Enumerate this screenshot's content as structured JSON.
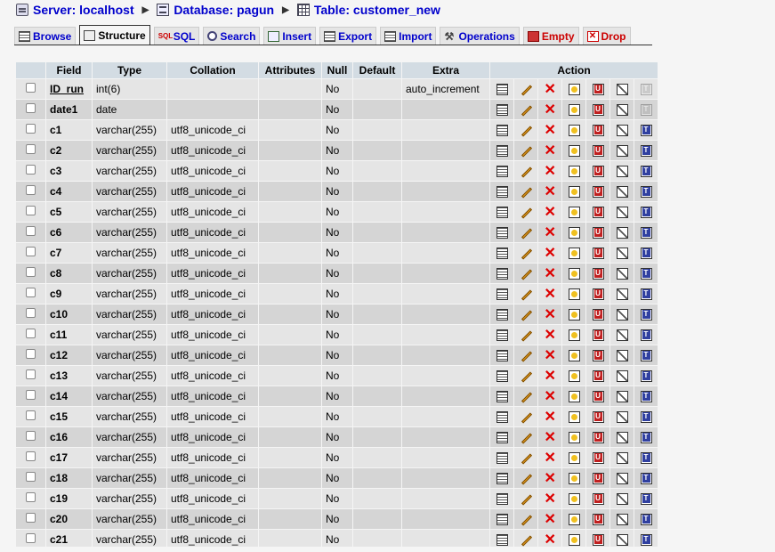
{
  "breadcrumb": {
    "server": "Server: localhost",
    "database": "Database: pagun",
    "table": "Table: customer_new"
  },
  "tabs": [
    {
      "label": "Browse",
      "icon": "browse-icon",
      "active": false
    },
    {
      "label": "Structure",
      "icon": "structure-icon",
      "active": true
    },
    {
      "label": "SQL",
      "icon": "sql-icon",
      "active": false
    },
    {
      "label": "Search",
      "icon": "search-icon",
      "active": false
    },
    {
      "label": "Insert",
      "icon": "insert-icon",
      "active": false
    },
    {
      "label": "Export",
      "icon": "export-icon",
      "active": false
    },
    {
      "label": "Import",
      "icon": "import-icon",
      "active": false
    },
    {
      "label": "Operations",
      "icon": "operations-icon",
      "active": false
    },
    {
      "label": "Empty",
      "icon": "empty-icon",
      "active": false,
      "red": true
    },
    {
      "label": "Drop",
      "icon": "drop-icon",
      "active": false,
      "red": true
    }
  ],
  "table": {
    "headers": {
      "field": "Field",
      "type": "Type",
      "collation": "Collation",
      "attributes": "Attributes",
      "null": "Null",
      "default": "Default",
      "extra": "Extra",
      "action": "Action"
    },
    "action_icons": [
      "browse-icon",
      "edit-icon",
      "delete-icon",
      "primary-key-icon",
      "unique-icon",
      "index-icon",
      "fulltext-icon"
    ],
    "rows": [
      {
        "field": "ID_run",
        "type": "int(6)",
        "collation": "",
        "attributes": "",
        "null": "No",
        "default": "",
        "extra": "auto_increment",
        "primary": true,
        "fulltext_enabled": false
      },
      {
        "field": "date1",
        "type": "date",
        "collation": "",
        "attributes": "",
        "null": "No",
        "default": "",
        "extra": "",
        "primary": false,
        "fulltext_enabled": false
      },
      {
        "field": "c1",
        "type": "varchar(255)",
        "collation": "utf8_unicode_ci",
        "attributes": "",
        "null": "No",
        "default": "",
        "extra": "",
        "primary": false,
        "fulltext_enabled": true
      },
      {
        "field": "c2",
        "type": "varchar(255)",
        "collation": "utf8_unicode_ci",
        "attributes": "",
        "null": "No",
        "default": "",
        "extra": "",
        "primary": false,
        "fulltext_enabled": true
      },
      {
        "field": "c3",
        "type": "varchar(255)",
        "collation": "utf8_unicode_ci",
        "attributes": "",
        "null": "No",
        "default": "",
        "extra": "",
        "primary": false,
        "fulltext_enabled": true
      },
      {
        "field": "c4",
        "type": "varchar(255)",
        "collation": "utf8_unicode_ci",
        "attributes": "",
        "null": "No",
        "default": "",
        "extra": "",
        "primary": false,
        "fulltext_enabled": true
      },
      {
        "field": "c5",
        "type": "varchar(255)",
        "collation": "utf8_unicode_ci",
        "attributes": "",
        "null": "No",
        "default": "",
        "extra": "",
        "primary": false,
        "fulltext_enabled": true
      },
      {
        "field": "c6",
        "type": "varchar(255)",
        "collation": "utf8_unicode_ci",
        "attributes": "",
        "null": "No",
        "default": "",
        "extra": "",
        "primary": false,
        "fulltext_enabled": true
      },
      {
        "field": "c7",
        "type": "varchar(255)",
        "collation": "utf8_unicode_ci",
        "attributes": "",
        "null": "No",
        "default": "",
        "extra": "",
        "primary": false,
        "fulltext_enabled": true
      },
      {
        "field": "c8",
        "type": "varchar(255)",
        "collation": "utf8_unicode_ci",
        "attributes": "",
        "null": "No",
        "default": "",
        "extra": "",
        "primary": false,
        "fulltext_enabled": true
      },
      {
        "field": "c9",
        "type": "varchar(255)",
        "collation": "utf8_unicode_ci",
        "attributes": "",
        "null": "No",
        "default": "",
        "extra": "",
        "primary": false,
        "fulltext_enabled": true
      },
      {
        "field": "c10",
        "type": "varchar(255)",
        "collation": "utf8_unicode_ci",
        "attributes": "",
        "null": "No",
        "default": "",
        "extra": "",
        "primary": false,
        "fulltext_enabled": true
      },
      {
        "field": "c11",
        "type": "varchar(255)",
        "collation": "utf8_unicode_ci",
        "attributes": "",
        "null": "No",
        "default": "",
        "extra": "",
        "primary": false,
        "fulltext_enabled": true
      },
      {
        "field": "c12",
        "type": "varchar(255)",
        "collation": "utf8_unicode_ci",
        "attributes": "",
        "null": "No",
        "default": "",
        "extra": "",
        "primary": false,
        "fulltext_enabled": true
      },
      {
        "field": "c13",
        "type": "varchar(255)",
        "collation": "utf8_unicode_ci",
        "attributes": "",
        "null": "No",
        "default": "",
        "extra": "",
        "primary": false,
        "fulltext_enabled": true
      },
      {
        "field": "c14",
        "type": "varchar(255)",
        "collation": "utf8_unicode_ci",
        "attributes": "",
        "null": "No",
        "default": "",
        "extra": "",
        "primary": false,
        "fulltext_enabled": true
      },
      {
        "field": "c15",
        "type": "varchar(255)",
        "collation": "utf8_unicode_ci",
        "attributes": "",
        "null": "No",
        "default": "",
        "extra": "",
        "primary": false,
        "fulltext_enabled": true
      },
      {
        "field": "c16",
        "type": "varchar(255)",
        "collation": "utf8_unicode_ci",
        "attributes": "",
        "null": "No",
        "default": "",
        "extra": "",
        "primary": false,
        "fulltext_enabled": true
      },
      {
        "field": "c17",
        "type": "varchar(255)",
        "collation": "utf8_unicode_ci",
        "attributes": "",
        "null": "No",
        "default": "",
        "extra": "",
        "primary": false,
        "fulltext_enabled": true
      },
      {
        "field": "c18",
        "type": "varchar(255)",
        "collation": "utf8_unicode_ci",
        "attributes": "",
        "null": "No",
        "default": "",
        "extra": "",
        "primary": false,
        "fulltext_enabled": true
      },
      {
        "field": "c19",
        "type": "varchar(255)",
        "collation": "utf8_unicode_ci",
        "attributes": "",
        "null": "No",
        "default": "",
        "extra": "",
        "primary": false,
        "fulltext_enabled": true
      },
      {
        "field": "c20",
        "type": "varchar(255)",
        "collation": "utf8_unicode_ci",
        "attributes": "",
        "null": "No",
        "default": "",
        "extra": "",
        "primary": false,
        "fulltext_enabled": true
      },
      {
        "field": "c21",
        "type": "varchar(255)",
        "collation": "utf8_unicode_ci",
        "attributes": "",
        "null": "No",
        "default": "",
        "extra": "",
        "primary": false,
        "fulltext_enabled": true
      }
    ]
  }
}
